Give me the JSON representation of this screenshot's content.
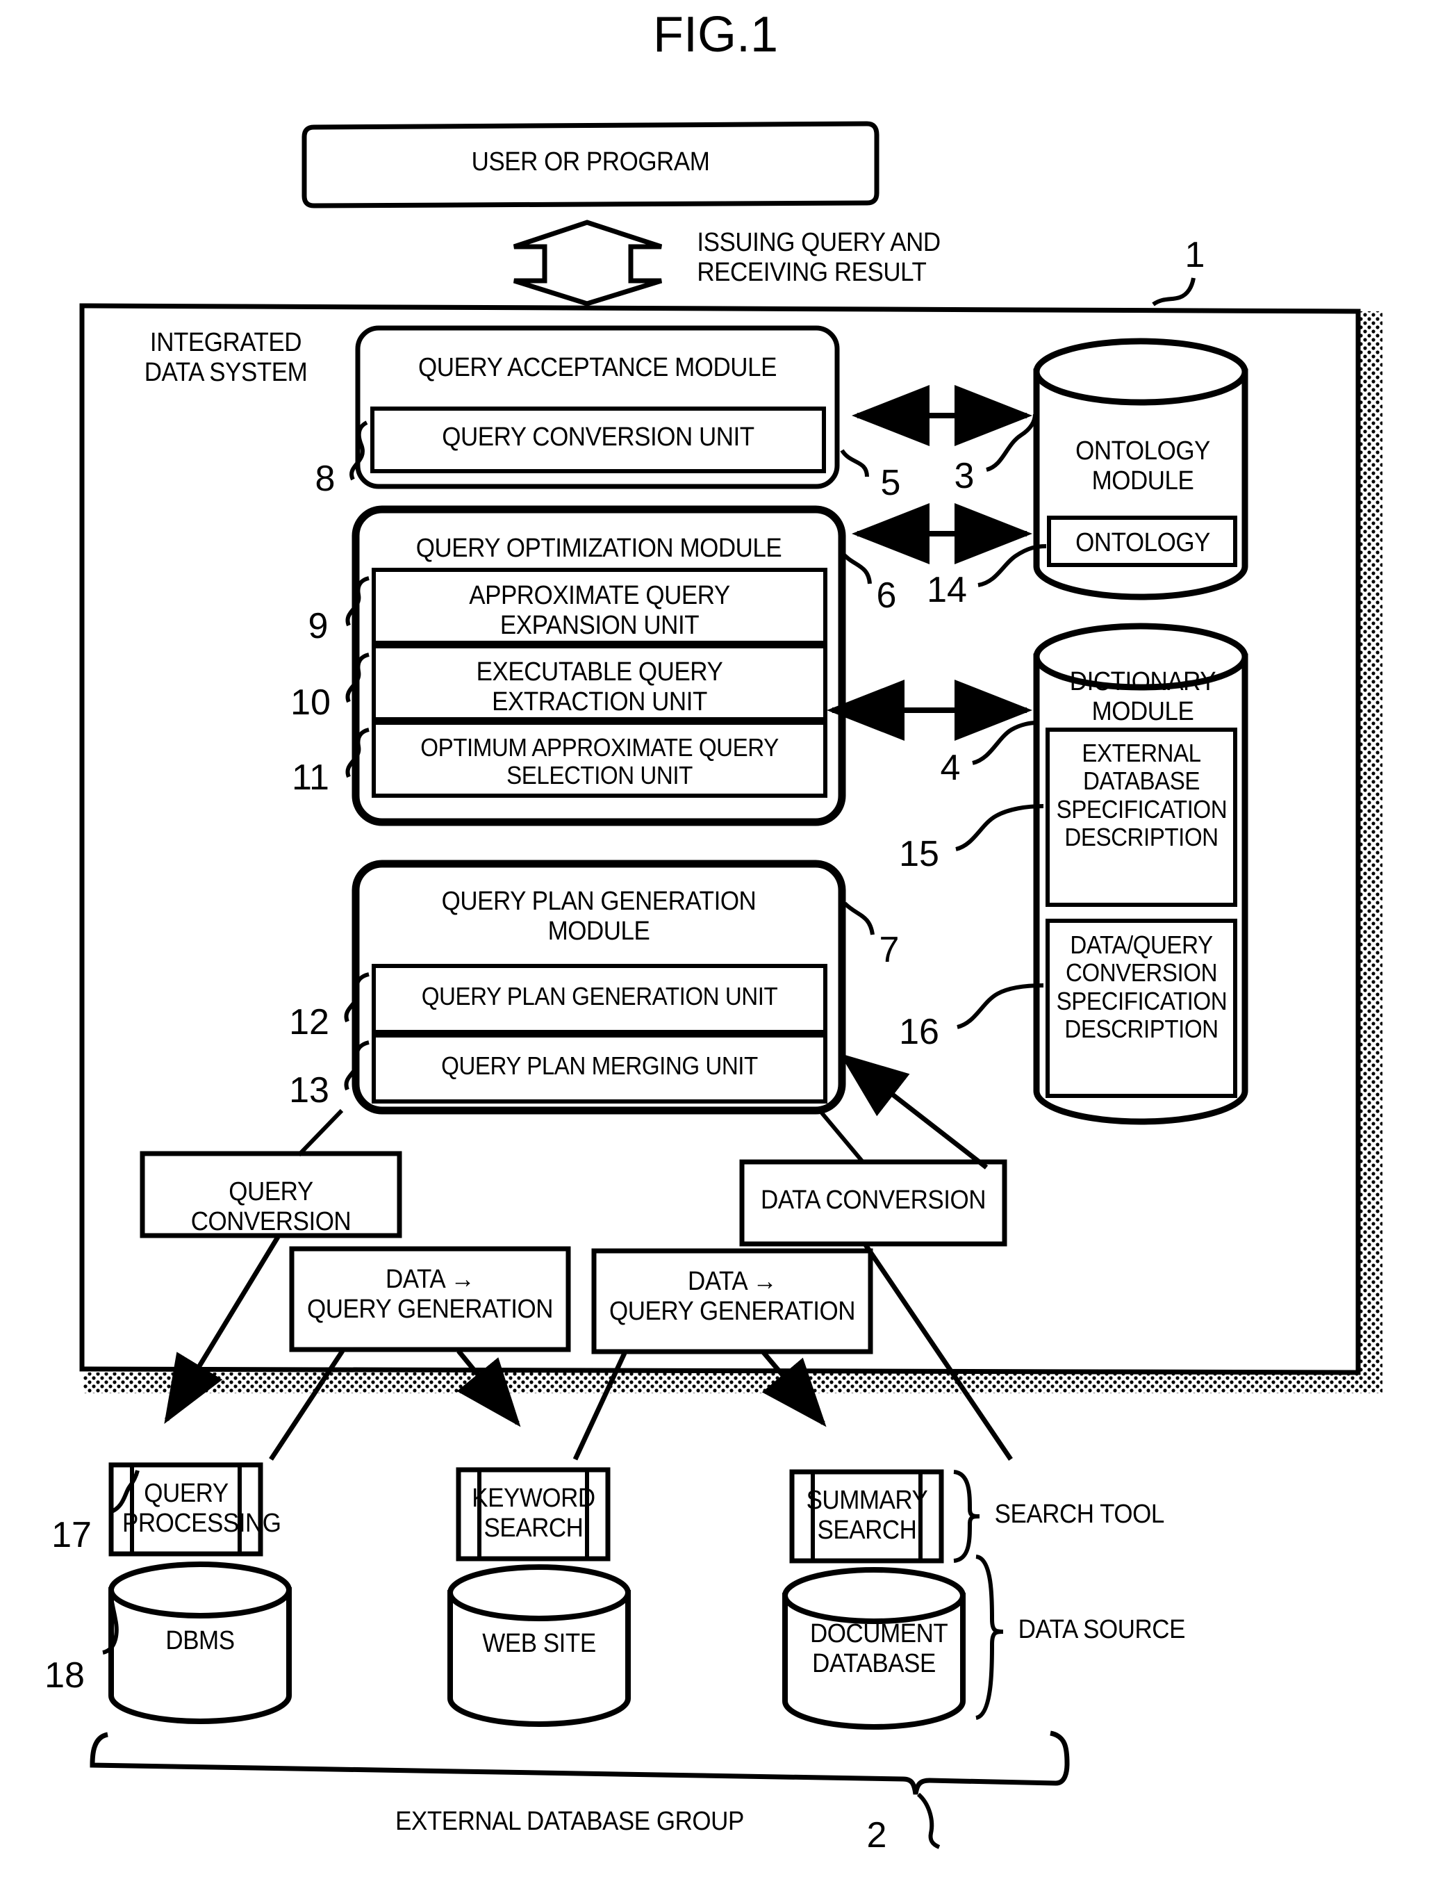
{
  "figure": {
    "title": "FIG.1"
  },
  "top": {
    "user_or_program": "USER OR PROGRAM",
    "issuing_query": "ISSUING QUERY AND\nRECEIVING RESULT"
  },
  "system": {
    "label": "INTEGRATED\nDATA SYSTEM",
    "ref": "1"
  },
  "modules": {
    "query_acceptance": {
      "title": "QUERY ACCEPTANCE MODULE",
      "ref": "5",
      "units": [
        {
          "label": "QUERY CONVERSION UNIT",
          "ref": "8"
        }
      ]
    },
    "query_optimization": {
      "title": "QUERY OPTIMIZATION MODULE",
      "ref": "6",
      "units": [
        {
          "label": "APPROXIMATE QUERY\nEXPANSION UNIT",
          "ref": "9"
        },
        {
          "label": "EXECUTABLE QUERY\nEXTRACTION UNIT",
          "ref": "10"
        },
        {
          "label": "OPTIMUM APPROXIMATE QUERY\nSELECTION UNIT",
          "ref": "11"
        }
      ]
    },
    "query_plan_generation": {
      "title": "QUERY PLAN GENERATION\nMODULE",
      "ref": "7",
      "units": [
        {
          "label": "QUERY PLAN GENERATION UNIT",
          "ref": "12"
        },
        {
          "label": "QUERY PLAN MERGING UNIT",
          "ref": "13"
        }
      ]
    },
    "ontology": {
      "title": "ONTOLOGY\nMODULE",
      "ref": "3",
      "inner": {
        "label": "ONTOLOGY",
        "ref": "14"
      }
    },
    "dictionary": {
      "title": "DICTIONARY\nMODULE",
      "ref": "4",
      "inner": [
        {
          "label": "EXTERNAL\nDATABASE\nSPECIFICATION\nDESCRIPTION",
          "ref": "15"
        },
        {
          "label": "DATA/QUERY\nCONVERSION\nSPECIFICATION\nDESCRIPTION",
          "ref": "16"
        }
      ]
    }
  },
  "conversion_boxes": {
    "query_conversion": "QUERY CONVERSION",
    "data_conversion": "DATA CONVERSION",
    "data_query_generation_left": "DATA →\nQUERY GENERATION",
    "data_query_generation_right": "DATA →\nQUERY GENERATION"
  },
  "search_tools": {
    "group_label": "SEARCH TOOL",
    "ref": "17",
    "items": [
      {
        "label": "QUERY\nPROCESSING"
      },
      {
        "label": "KEYWORD\nSEARCH"
      },
      {
        "label": "SUMMARY\nSEARCH"
      }
    ]
  },
  "data_sources": {
    "group_label": "DATA SOURCE",
    "ref": "18",
    "items": [
      {
        "label": "DBMS"
      },
      {
        "label": "WEB SITE"
      },
      {
        "label": "DOCUMENT\nDATABASE"
      }
    ]
  },
  "external_group": {
    "label": "EXTERNAL DATABASE GROUP",
    "ref": "2"
  }
}
